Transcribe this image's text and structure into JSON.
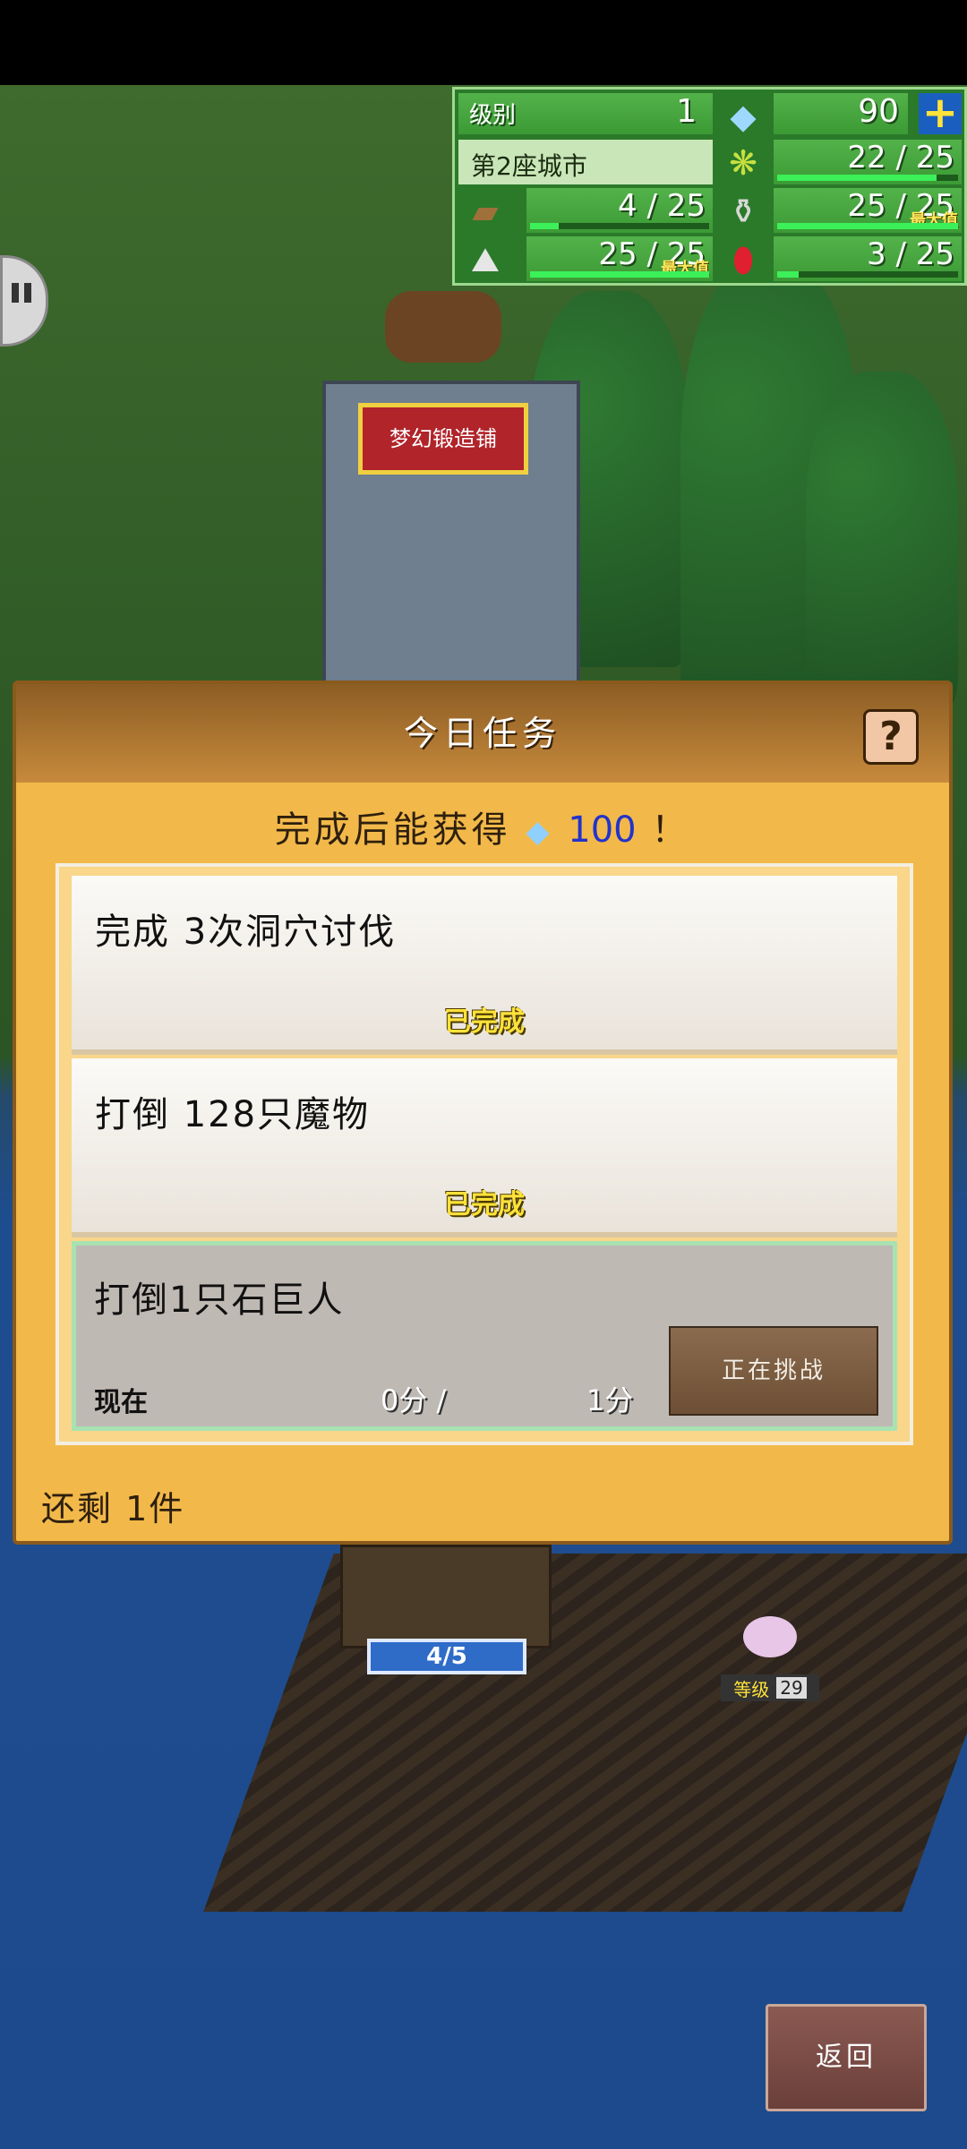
{
  "hud": {
    "level_label": "级别",
    "level_value": "1",
    "gems": "90",
    "city": "第2座城市",
    "grass": "22 / 25",
    "grass_fill": 0.88,
    "wood": "4 / 25",
    "wood_fill": 0.16,
    "meat": "25 / 25",
    "meat_fill": 1.0,
    "meat_max": "最大值",
    "ore": "25 / 25",
    "ore_fill": 1.0,
    "ore_max": "最大值",
    "ruby": "3 / 25",
    "ruby_fill": 0.12
  },
  "map": {
    "shop_sign": "梦幻锻造铺",
    "counter": "4/5",
    "monster_level_label": "等级",
    "monster_level": "29"
  },
  "dialog": {
    "title": "今日任务",
    "help": "?",
    "reward_prefix": "完成后能获得",
    "reward_value": "100",
    "reward_suffix": "！",
    "tasks": [
      {
        "title": "完成 3次洞穴讨伐",
        "status": "已完成"
      },
      {
        "title": "打倒 128只魔物",
        "status": "已完成"
      },
      {
        "title": "打倒1只石巨人",
        "current_label": "现在",
        "current": "0分 /",
        "target": "1分",
        "button": "正在挑战"
      }
    ],
    "remaining": "还剩 1件"
  },
  "back_button": "返回",
  "colors": {
    "gem": "#9fd8ff",
    "ruby": "#e02030",
    "hud_bg": "#2a7a2a"
  }
}
